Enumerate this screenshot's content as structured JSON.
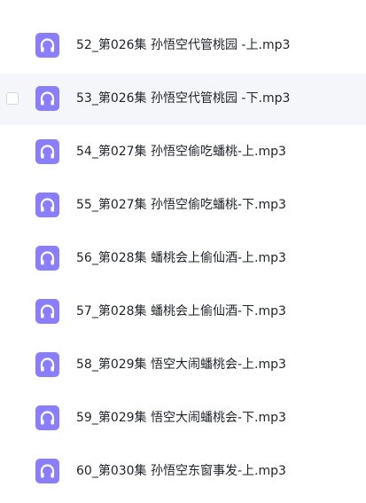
{
  "files": [
    {
      "name": "52_第026集 孙悟空代管桃园 -上.mp3",
      "icon": "audio-file-icon"
    },
    {
      "name": "53_第026集 孙悟空代管桃园 -下.mp3",
      "icon": "audio-file-icon"
    },
    {
      "name": "54_第027集 孙悟空偷吃蟠桃-上.mp3",
      "icon": "audio-file-icon"
    },
    {
      "name": "55_第027集 孙悟空偷吃蟠桃-下.mp3",
      "icon": "audio-file-icon"
    },
    {
      "name": "56_第028集 蟠桃会上偷仙酒-上.mp3",
      "icon": "audio-file-icon"
    },
    {
      "name": "57_第028集 蟠桃会上偷仙酒-下.mp3",
      "icon": "audio-file-icon"
    },
    {
      "name": "58_第029集 悟空大闹蟠桃会-上.mp3",
      "icon": "audio-file-icon"
    },
    {
      "name": "59_第029集 悟空大闹蟠桃会-下.mp3",
      "icon": "audio-file-icon"
    },
    {
      "name": "60_第030集 孙悟空东窗事发-上.mp3",
      "icon": "audio-file-icon"
    }
  ],
  "colors": {
    "icon_purple": "#8a7dff",
    "hover_row": "#f5f6fa",
    "text": "#1f2329"
  }
}
